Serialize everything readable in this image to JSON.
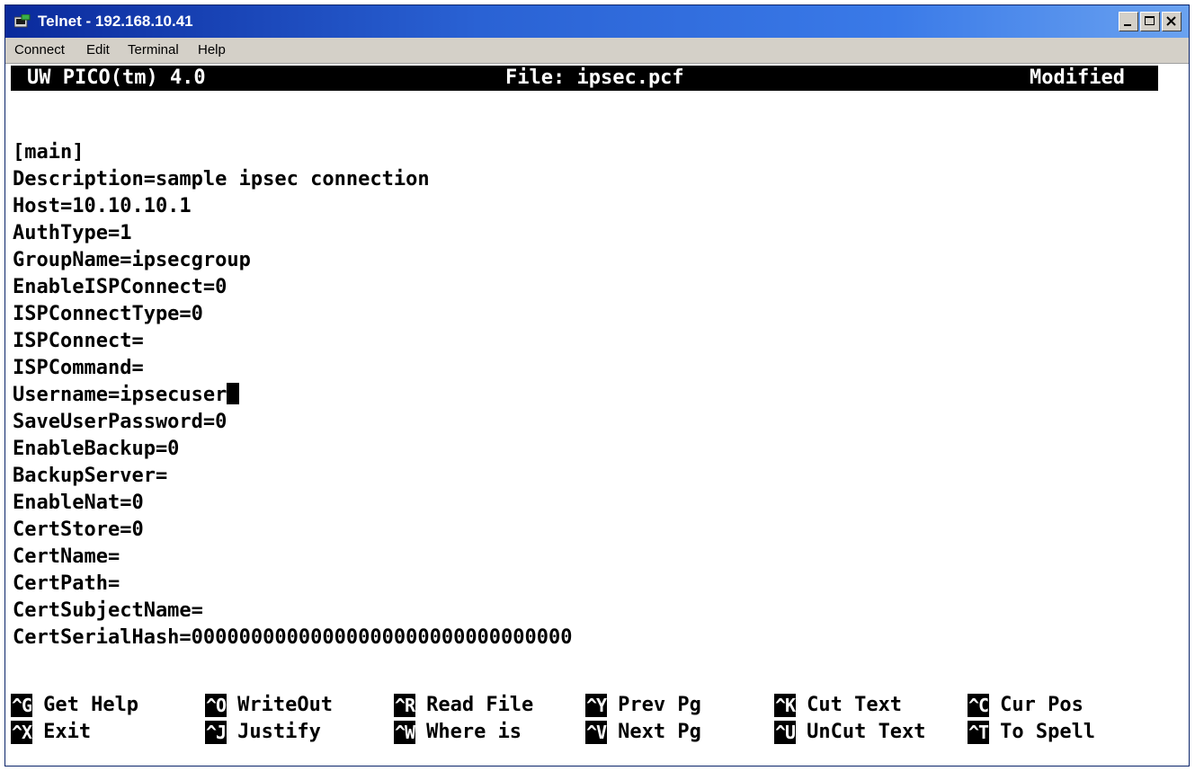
{
  "window": {
    "title": "Telnet - 192.168.10.41",
    "controls": [
      "minimize-icon",
      "maximize-icon",
      "close-icon"
    ]
  },
  "menu": {
    "items": [
      {
        "label": "Connect"
      },
      {
        "label": "Edit"
      },
      {
        "label": "Terminal"
      },
      {
        "label": "Help"
      }
    ]
  },
  "editor": {
    "app_name": "UW PICO(tm) 4.0",
    "file": "File: ipsec.pcf",
    "status": "Modified"
  },
  "file_lines": [
    "[main]",
    "Description=sample ipsec connection",
    "Host=10.10.10.1",
    "AuthType=1",
    "GroupName=ipsecgroup",
    "EnableISPConnect=0",
    "ISPConnectType=0",
    "ISPConnect=",
    "ISPCommand=",
    "Username=ipsecuser",
    "SaveUserPassword=0",
    "EnableBackup=0",
    "BackupServer=",
    "EnableNat=0",
    "CertStore=0",
    "CertName=",
    "CertPath=",
    "CertSubjectName=",
    "CertSerialHash=00000000000000000000000000000000"
  ],
  "shortcuts": {
    "row1": [
      {
        "key": "^G",
        "label": "Get Help"
      },
      {
        "key": "^O",
        "label": "WriteOut"
      },
      {
        "key": "^R",
        "label": "Read File"
      },
      {
        "key": "^Y",
        "label": "Prev Pg"
      },
      {
        "key": "^K",
        "label": "Cut Text"
      },
      {
        "key": "^C",
        "label": "Cur Pos"
      }
    ],
    "row2": [
      {
        "key": "^X",
        "label": "Exit"
      },
      {
        "key": "^J",
        "label": "Justify"
      },
      {
        "key": "^W",
        "label": "Where is"
      },
      {
        "key": "^V",
        "label": "Next Pg"
      },
      {
        "key": "^U",
        "label": "UnCut Text"
      },
      {
        "key": "^T",
        "label": "To Spell"
      }
    ]
  },
  "colors": {
    "title_bar_start": "#0a2a9c",
    "title_bar_end": "#6aa2f0",
    "chrome": "#d4d0c8",
    "terminal_bg": "#ffffff",
    "terminal_fg": "#000000"
  }
}
